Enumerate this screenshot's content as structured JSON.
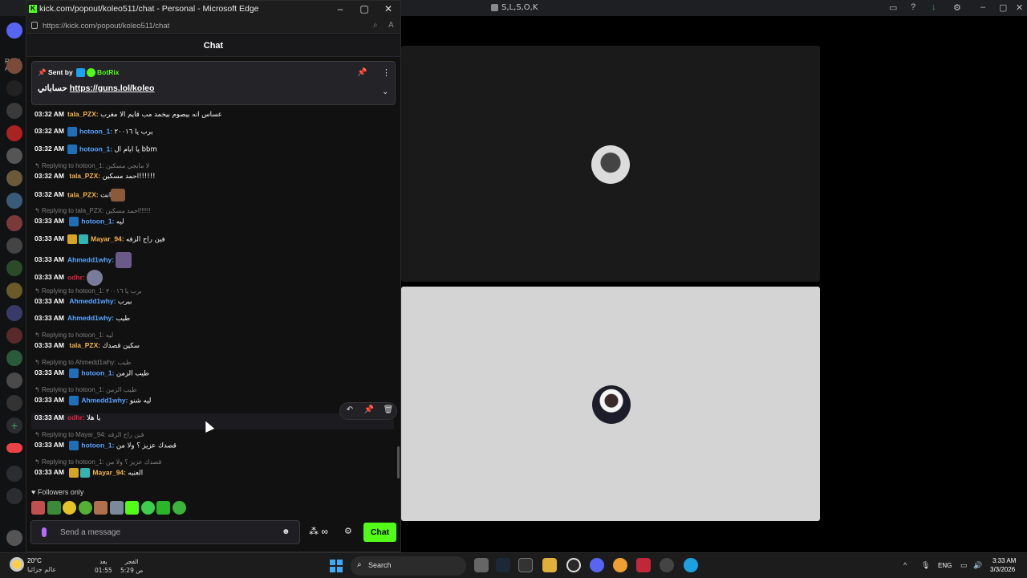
{
  "background_app": {
    "title": "S,L,S,O,K",
    "read_label": "Read A"
  },
  "browser": {
    "window_title": "kick.com/popout/koleo511/chat - Personal - Microsoft Edge",
    "url": "https://kick.com/popout/koleo511/chat"
  },
  "chat": {
    "header": "Chat",
    "pinned": {
      "sent_by_label": "Sent by",
      "bot_name": "BotRix",
      "message_prefix": "حساباتي",
      "link": "https://guns.lol/koleo"
    },
    "messages": [
      {
        "time": "03:32 AM",
        "user": "tala_PZX:",
        "text": "عساس انه بيصوم بيخمد مب قايم الا مغرب"
      },
      {
        "time": "03:32 AM",
        "user": "hotoon_1:",
        "text": "برب يا ٢٠٠١٦"
      },
      {
        "time": "03:32 AM",
        "user": "hotoon_1:",
        "text": "يا ابام ال bbm"
      },
      {
        "reply": "Replying to hotoon_1: لا مابجي مسكين",
        "time": "03:32 AM",
        "user": "tala_PZX:",
        "text": "احمد مسكين!!!!!!"
      },
      {
        "time": "03:32 AM",
        "user": "tala_PZX:",
        "text": "انت"
      },
      {
        "reply": "Replying to tala_PZX: احمد مسكين!!!!!!",
        "time": "03:33 AM",
        "user": "hotoon_1:",
        "text": "ليه"
      },
      {
        "time": "03:33 AM",
        "user": "Mayar_94:",
        "text": "فين راح الزفه"
      },
      {
        "time": "03:33 AM",
        "user": "Ahmedd1why:",
        "text": ""
      },
      {
        "time": "03:33 AM",
        "user": "odhr:",
        "text": ""
      },
      {
        "reply": "Replying to hotoon_1: برب يا ٢٠٠١٦",
        "time": "03:33 AM",
        "user": "Ahmedd1why:",
        "text": "بيرب"
      },
      {
        "time": "03:33 AM",
        "user": "Ahmedd1why:",
        "text": "طيب"
      },
      {
        "reply": "Replying to hotoon_1: ليه",
        "time": "03:33 AM",
        "user": "tala_PZX:",
        "text": "سكين قصدك"
      },
      {
        "reply": "Replying to Ahmedd1why: طيب",
        "time": "03:33 AM",
        "user": "hotoon_1:",
        "text": "طيب الزمن"
      },
      {
        "reply": "Replying to hotoon_1: طيب الزمن",
        "time": "03:33 AM",
        "user": "Ahmedd1why:",
        "text": "ليه شنو"
      },
      {
        "time": "03:33 AM",
        "user": "odhr:",
        "text": "يا هلا"
      },
      {
        "reply": "Replying to Mayar_94: فين راح الزفه",
        "time": "03:33 AM",
        "user": "hotoon_1:",
        "text": "قصدك عزيز ؟ ولا من"
      },
      {
        "reply": "Replying to hotoon_1: قصدك عزيز ؟ ولا من",
        "time": "03:33 AM",
        "user": "Mayar_94:",
        "text": "العنبه"
      }
    ],
    "followers_only": "Followers only",
    "input_placeholder": "Send a message",
    "send_button": "Chat",
    "points_label": "∞"
  },
  "taskbar": {
    "temperature": "20°C",
    "weather_desc": "عالم جزائيا",
    "prayer1_label": "بعد",
    "prayer1_time": "01:55",
    "prayer2_label": "الفجر",
    "prayer2_time": "5:29 ص",
    "search_label": "Search",
    "language": "ENG",
    "clock_time": "3:33 AM",
    "clock_date": "3/3/2026"
  },
  "colors": {
    "kick_green": "#53fc18",
    "accent_blue": "#5aa5ff",
    "accent_orange": "#f5b547",
    "accent_red": "#e0233f"
  }
}
